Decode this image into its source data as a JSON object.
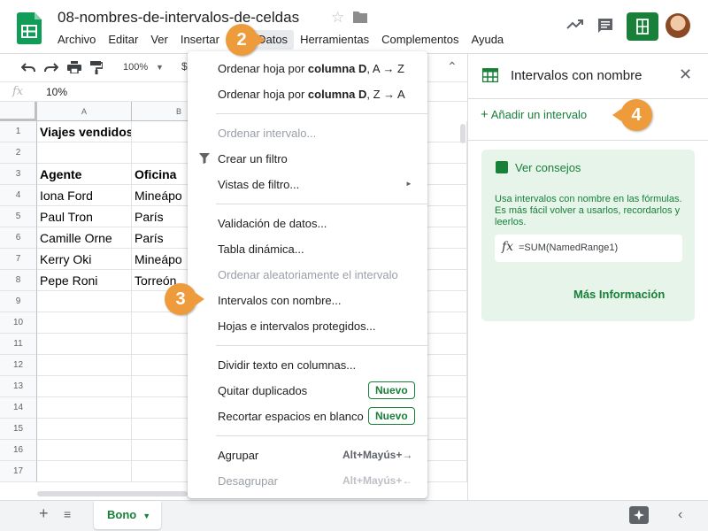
{
  "header": {
    "doc_title": "08-nombres-de-intervalos-de-celdas",
    "menu": [
      "Archivo",
      "Editar",
      "Ver",
      "Insertar",
      "Fo",
      "Datos",
      "Herramientas",
      "Complementos",
      "Ayuda"
    ]
  },
  "toolbar": {
    "zoom": "100%",
    "currency": "$"
  },
  "formula_bar": {
    "fx": "fx",
    "value": "10%"
  },
  "grid": {
    "columns": [
      "A",
      "B"
    ],
    "rows": [
      "1",
      "2",
      "3",
      "4",
      "5",
      "6",
      "7",
      "8",
      "9",
      "10",
      "11",
      "12",
      "13",
      "14",
      "15",
      "16",
      "17"
    ],
    "cells": [
      [
        "Viajes vendidos",
        ""
      ],
      [
        "",
        ""
      ],
      [
        "Agente",
        "Oficina"
      ],
      [
        "Iona Ford",
        "Mineápo"
      ],
      [
        "Paul Tron",
        "París"
      ],
      [
        "Camille Orne",
        "París"
      ],
      [
        "Kerry Oki",
        "Mineápo"
      ],
      [
        "Pepe Roni",
        "Torreón"
      ]
    ]
  },
  "dropdown": {
    "items": [
      {
        "type": "item",
        "pre": "Ordenar hoja por ",
        "bold": "columna D",
        "post": ", A → Z",
        "disabled": false
      },
      {
        "type": "item",
        "pre": "Ordenar hoja por ",
        "bold": "columna D",
        "post": ", Z → A",
        "disabled": false
      },
      {
        "type": "sep"
      },
      {
        "type": "item",
        "label": "Ordenar intervalo...",
        "disabled": true
      },
      {
        "type": "item",
        "label": "Crear un filtro",
        "icon": "filter-icon",
        "disabled": false
      },
      {
        "type": "item",
        "label": "Vistas de filtro...",
        "arrow": "►",
        "disabled": false
      },
      {
        "type": "sep"
      },
      {
        "type": "item",
        "label": "Validación de datos...",
        "disabled": false
      },
      {
        "type": "item",
        "label": "Tabla dinámica...",
        "disabled": false
      },
      {
        "type": "item",
        "label": "Ordenar aleatoriamente el intervalo",
        "disabled": true
      },
      {
        "type": "item",
        "label": "Intervalos con nombre...",
        "disabled": false
      },
      {
        "type": "item",
        "label": "Hojas e intervalos protegidos...",
        "disabled": false
      },
      {
        "type": "sep"
      },
      {
        "type": "item",
        "label": "Dividir texto en columnas...",
        "disabled": false
      },
      {
        "type": "item",
        "label": "Quitar duplicados",
        "badge": "Nuevo",
        "disabled": false
      },
      {
        "type": "item",
        "label": "Recortar espacios en blanco",
        "badge": "Nuevo",
        "disabled": false
      },
      {
        "type": "sep"
      },
      {
        "type": "item",
        "label": "Agrupar",
        "shortcut": "Alt+Mayús+→",
        "disabled": false
      },
      {
        "type": "item",
        "label": "Desagrupar",
        "shortcut": "Alt+Mayús+←",
        "disabled": true
      }
    ]
  },
  "sidepanel": {
    "title": "Intervalos con nombre",
    "add_range": "Añadir un intervalo",
    "tips_title": "Ver consejos",
    "tips_text": "Usa intervalos con nombre en las fórmulas. Es más fácil volver a usarlos, recordarlos y leerlos.",
    "tips_fx": "fx",
    "tips_formula": "=SUM(NamedRange1)",
    "tips_more": "Más Información"
  },
  "sheets": {
    "active_tab": "Bono"
  },
  "steps": [
    "2",
    "3",
    "4"
  ],
  "colors": {
    "accent": "#188038",
    "step": "#ee9b3b"
  }
}
